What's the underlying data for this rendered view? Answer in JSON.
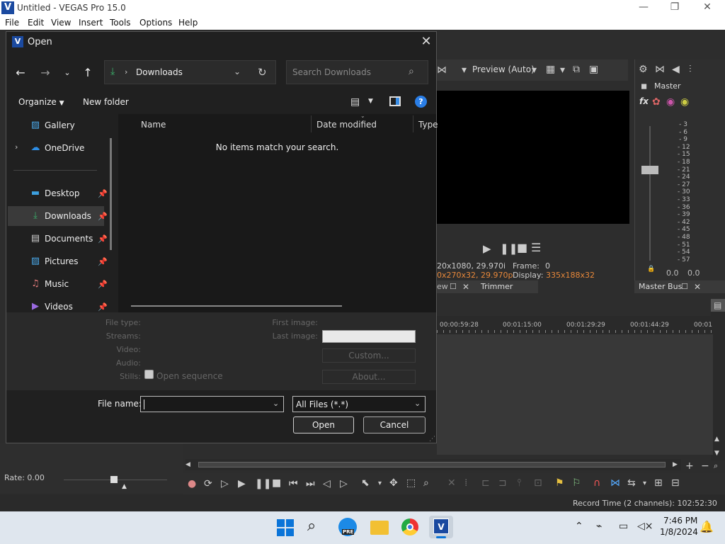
{
  "app": {
    "title": "Untitled - VEGAS Pro 15.0",
    "logo_letter": "V",
    "window_controls": {
      "minimize": "—",
      "maximize": "❐",
      "close": "✕"
    }
  },
  "menu": [
    "File",
    "Edit",
    "View",
    "Insert",
    "Tools",
    "Options",
    "Help"
  ],
  "preview": {
    "mode_label": "Preview (Auto)",
    "info": {
      "res1": "20x1080, 29.970i",
      "res2": "0x270x32, 29.970p",
      "frame_label": "Frame:",
      "frame_value": "0",
      "display_label": "Display:",
      "display_value": "335x188x32"
    },
    "tabs": {
      "left_partial": "ew",
      "trimmer": "Trimmer"
    }
  },
  "master": {
    "label": "Master",
    "fx": "fx",
    "scale": [
      "3",
      "6",
      "9",
      "12",
      "15",
      "18",
      "21",
      "24",
      "27",
      "30",
      "33",
      "36",
      "39",
      "42",
      "45",
      "48",
      "51",
      "54",
      "57"
    ],
    "levels": [
      "0.0",
      "0.0"
    ],
    "bus_tab": "Master Bus"
  },
  "timeline": {
    "ticks": [
      "00:00:59:28",
      "00:01:15:00",
      "00:01:29:29",
      "00:01:44:29",
      "00:01"
    ]
  },
  "rate": "Rate: 0.00",
  "status": {
    "record_time": "Record Time (2 channels): 102:52:30"
  },
  "dialog": {
    "title": "Open",
    "address": {
      "folder": "Downloads"
    },
    "search_placeholder": "Search Downloads",
    "commands": {
      "organize": "Organize",
      "new_folder": "New folder"
    },
    "nav": [
      {
        "label": "Gallery",
        "pinned": false
      },
      {
        "label": "OneDrive",
        "pinned": false,
        "expandable": true
      },
      {
        "label": "Desktop",
        "pinned": true
      },
      {
        "label": "Downloads",
        "pinned": true,
        "selected": true
      },
      {
        "label": "Documents",
        "pinned": true
      },
      {
        "label": "Pictures",
        "pinned": true
      },
      {
        "label": "Music",
        "pinned": true
      },
      {
        "label": "Videos",
        "pinned": true
      }
    ],
    "columns": {
      "name": "Name",
      "date": "Date modified",
      "type": "Type"
    },
    "empty_message": "No items match your search.",
    "info_labels": {
      "file_type": "File type:",
      "streams": "Streams:",
      "video": "Video:",
      "audio": "Audio:",
      "stills": "Stills:",
      "first_image": "First image:",
      "last_image": "Last image:",
      "open_sequence": "Open sequence"
    },
    "buttons": {
      "custom": "Custom...",
      "about": "About...",
      "open": "Open",
      "cancel": "Cancel"
    },
    "file_name_label": "File name:",
    "file_name_value": "",
    "file_type_value": "All Files (*.*)"
  },
  "taskbar": {
    "time": "7:46 PM",
    "date": "1/8/2024",
    "pre_badge": "PRE"
  }
}
